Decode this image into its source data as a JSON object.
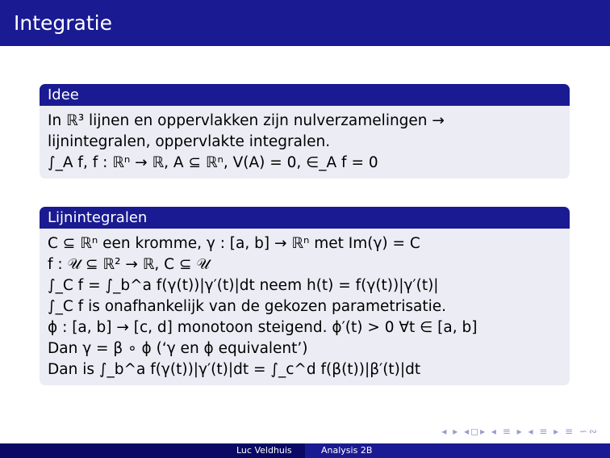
{
  "slide": {
    "title": "Integratie"
  },
  "block1": {
    "title": "Idee",
    "lines": [
      "In ℝ³ lijnen en oppervlakken zijn nulverzamelingen →",
      "lijnintegralen, oppervlakte integralen.",
      "∫_A f, f : ℝⁿ → ℝ, A ⊆ ℝⁿ, V(A) = 0, ∈_A f = 0"
    ]
  },
  "block2": {
    "title": "Lijnintegralen",
    "lines": [
      "C ⊆ ℝⁿ een kromme, γ : [a, b] → ℝⁿ met Im(γ) = C",
      "f : 𝒰 ⊆ ℝ² → ℝ, C ⊆ 𝒰",
      "∫_C f = ∫_b^a f(γ(t))|γ′(t)|dt neem h(t) = f(γ(t))|γ′(t)|",
      "∫_C f is onafhankelijk van de gekozen parametrisatie.",
      "ϕ : [a, b] → [c, d] monotoon steigend. ϕ′(t) > 0 ∀t ∈ [a, b]",
      "Dan γ = β ∘ ϕ (‘γ en ϕ equivalent’)",
      "Dan is ∫_b^a f(γ(t))|γ′(t)|dt = ∫_c^d f(β(t))|β′(t)|dt"
    ]
  },
  "footer": {
    "author": "Luc Veldhuis",
    "course": "Analysis 2B"
  },
  "nav": {
    "symbols": "◂ ▸ ◂◻▸ ◂ ≡ ▸ ◂ ≡ ▸ ≡ ∽∾"
  }
}
